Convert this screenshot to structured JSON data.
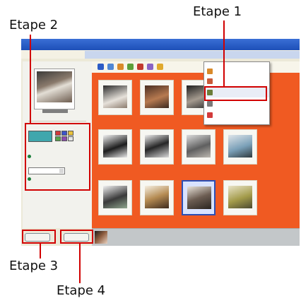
{
  "annotations": {
    "step1": "Etape 1",
    "step2": "Etape 2",
    "step3": "Etape 3",
    "step4": "Etape 4"
  },
  "accent_colors": {
    "callout_red": "#d10000",
    "album_orange": "#f05a22",
    "swatch_teal": "#3fa7ad"
  },
  "screen": {
    "title_bar": "",
    "menu_bar": "",
    "tabs": [
      "",
      "",
      "",
      ""
    ],
    "left_pane": {
      "swatches_label": "",
      "option_label": "",
      "size_caption": "",
      "size_value": "",
      "apply_label": ""
    },
    "context_menu": {
      "items": [
        {
          "label": "",
          "icon": "album-icon"
        },
        {
          "label": "",
          "icon": "photo-icon"
        },
        {
          "label": "",
          "icon": "page-icon"
        },
        {
          "label": "",
          "icon": "print-icon"
        },
        {
          "label": "",
          "icon": "web-icon"
        }
      ]
    },
    "buttons": {
      "previous": "",
      "next": ""
    }
  }
}
